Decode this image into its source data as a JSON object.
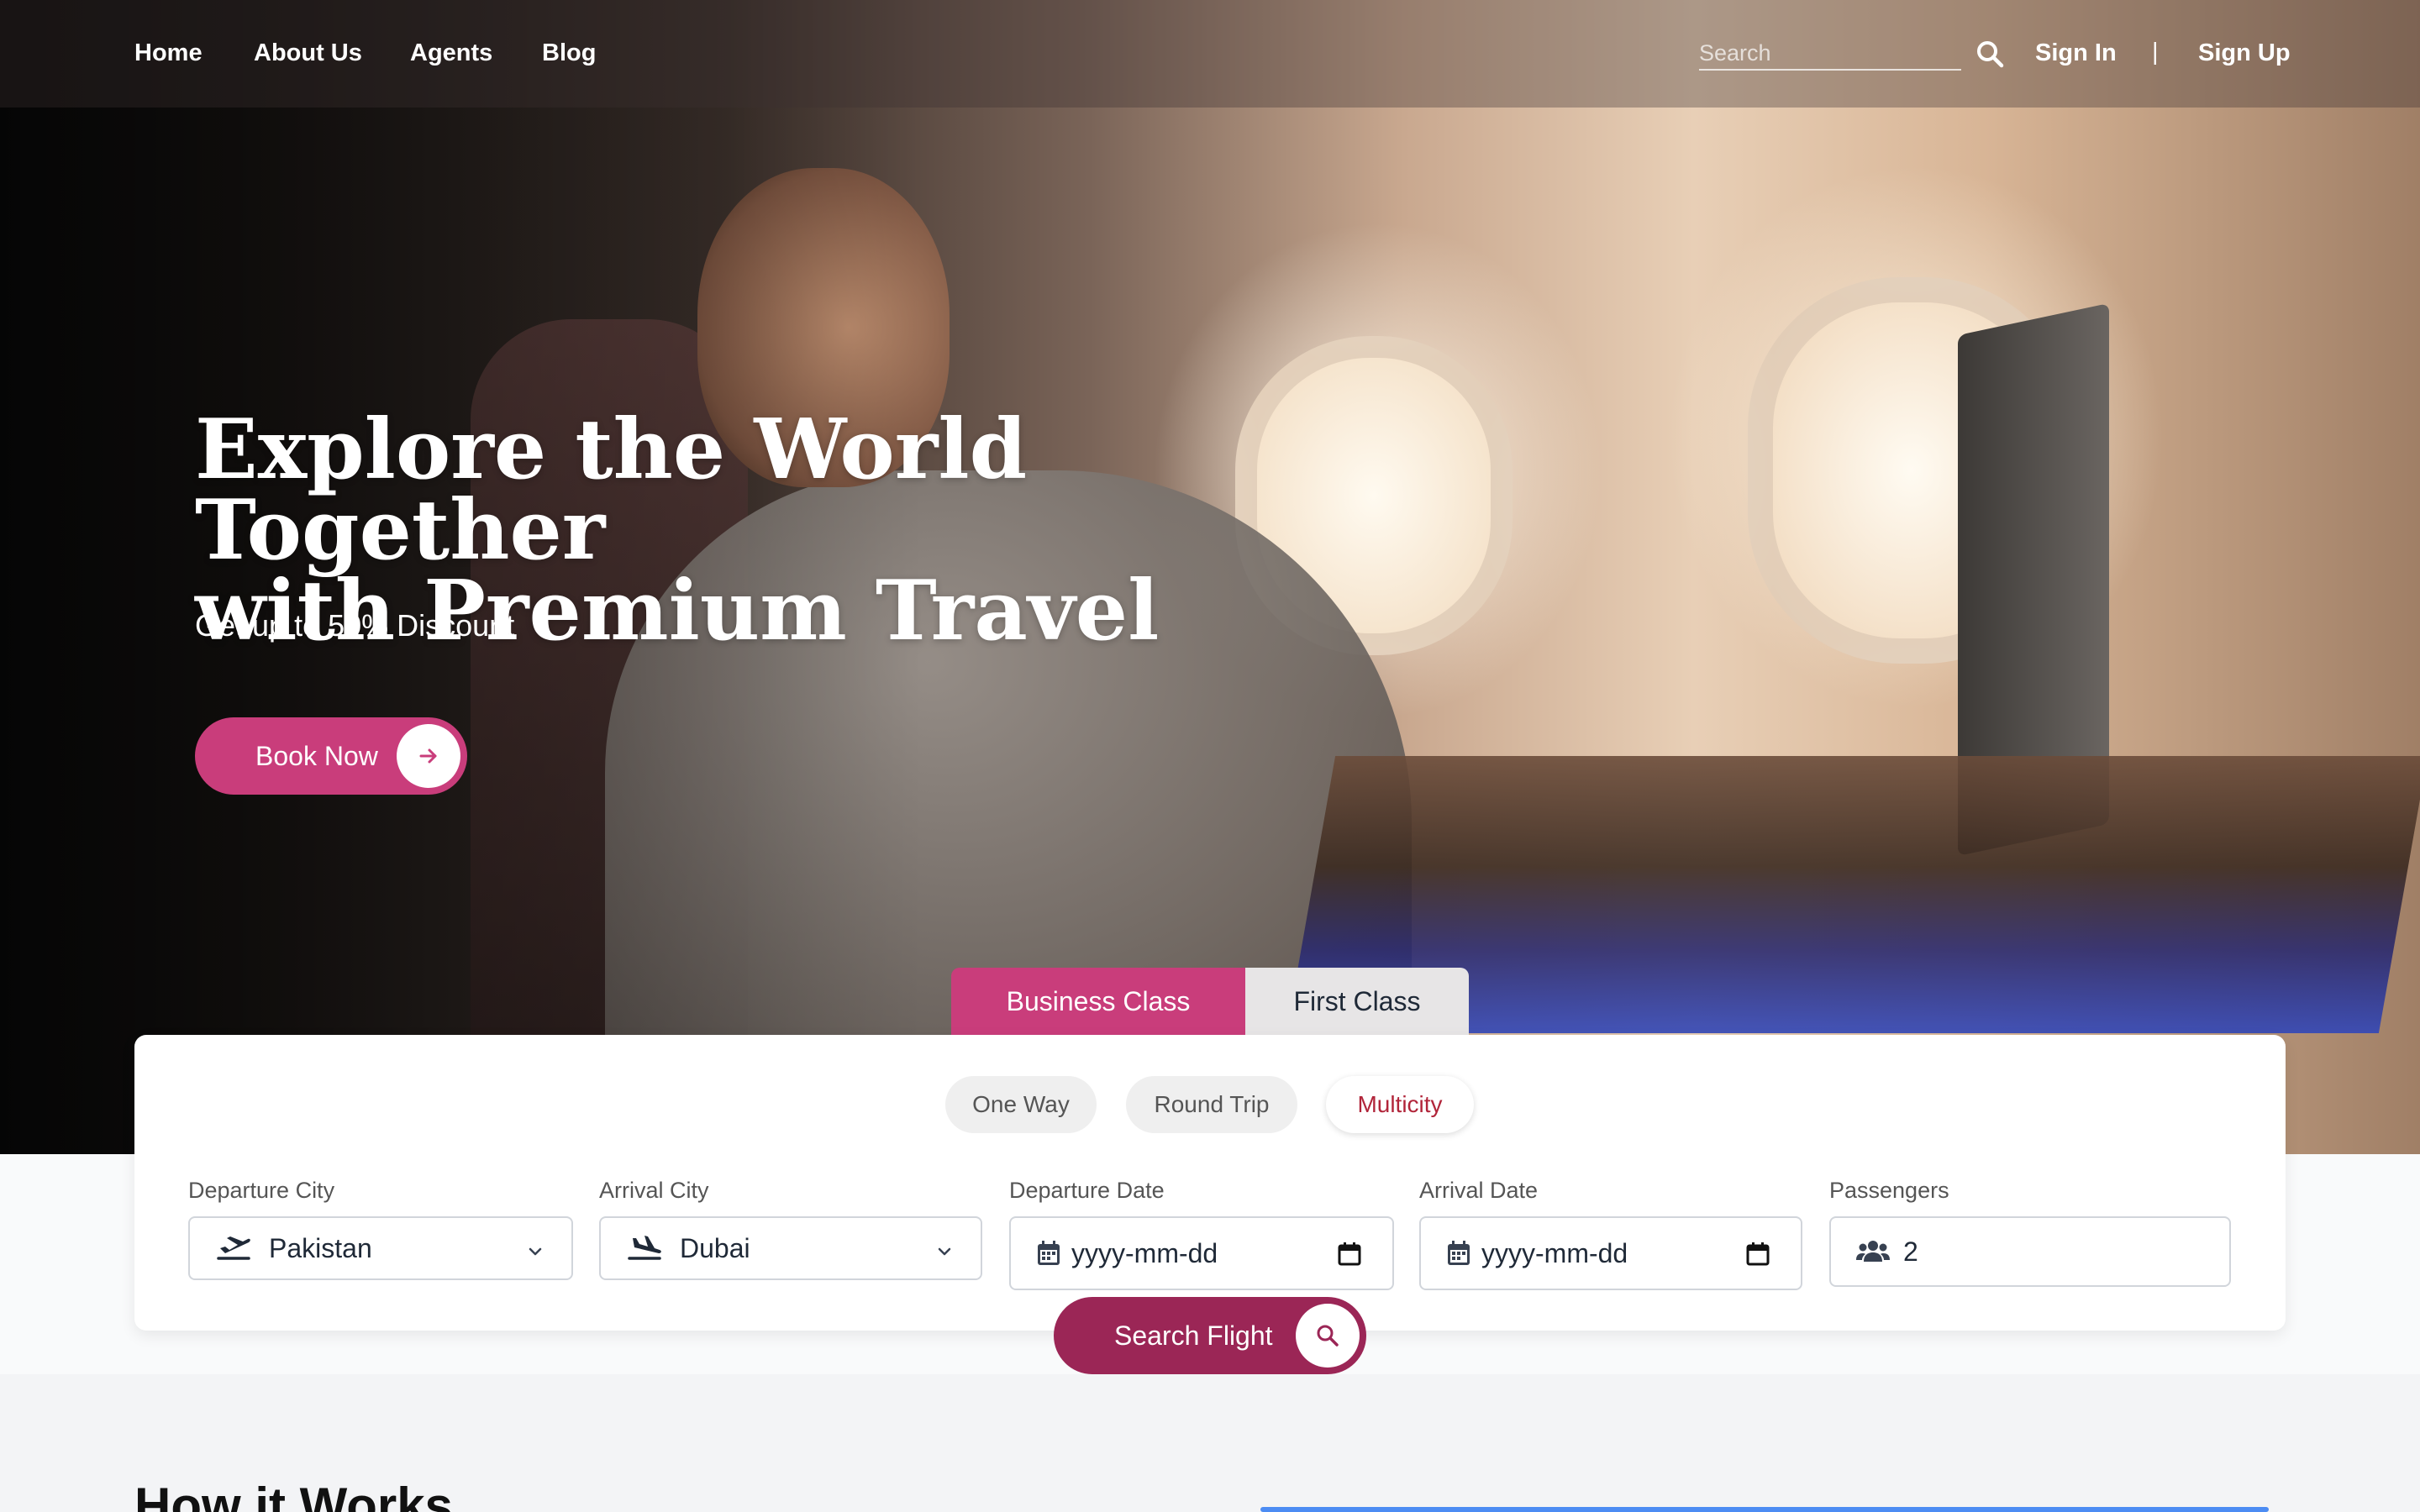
{
  "nav": {
    "links": [
      "Home",
      "About Us",
      "Agents",
      "Blog"
    ],
    "search_placeholder": "Search",
    "sign_in": "Sign In",
    "divider": "|",
    "sign_up": "Sign Up"
  },
  "hero": {
    "title_line1": "Explore the World Together",
    "title_line2": "with Premium Travel",
    "subtitle": "Get up to 50% Discount",
    "book_label": "Book Now"
  },
  "class_tabs": {
    "active": "Business Class",
    "inactive": "First Class"
  },
  "trip_types": {
    "one_way": "One Way",
    "round_trip": "Round Trip",
    "multicity": "Multicity",
    "selected": "Multicity"
  },
  "fields": {
    "departure_city": {
      "label": "Departure City",
      "value": "Pakistan"
    },
    "arrival_city": {
      "label": "Arrival City",
      "value": "Dubai"
    },
    "departure_date": {
      "label": "Departure Date",
      "value": "yyyy-mm-dd"
    },
    "arrival_date": {
      "label": "Arrival Date",
      "value": "yyyy-mm-dd"
    },
    "passengers": {
      "label": "Passengers",
      "value": "2"
    }
  },
  "search_button": "Search Flight",
  "section": {
    "how_it_works": "How it Works"
  },
  "colors": {
    "accent_pink": "#c93d7b",
    "search_button": "#9b2656",
    "multicity_text": "#b1253a"
  }
}
